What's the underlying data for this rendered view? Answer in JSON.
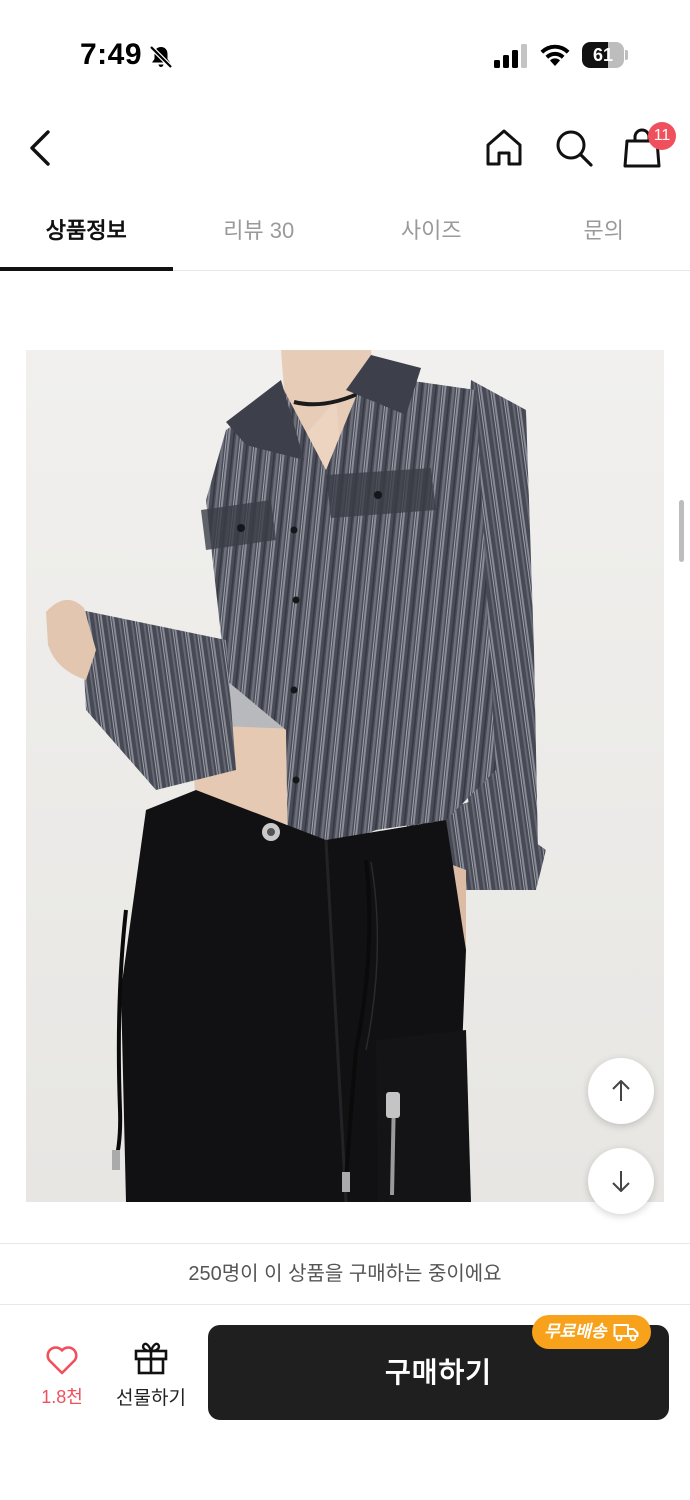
{
  "status_bar": {
    "time": "7:49",
    "battery": "61",
    "battery_level": 0.61
  },
  "header": {
    "cart_count": "11"
  },
  "tabs": [
    {
      "label": "상품정보",
      "active": true
    },
    {
      "label": "리뷰 30",
      "active": false
    },
    {
      "label": "사이즈",
      "active": false
    },
    {
      "label": "문의",
      "active": false
    }
  ],
  "buyers_banner": "250명이 이 상품을 구매하는 중이에요",
  "bottom_bar": {
    "like_count": "1.8천",
    "gift_label": "선물하기",
    "buy_label": "구매하기",
    "free_shipping": "무료배송"
  },
  "colors": {
    "accent": "#f0505c",
    "buy_button": "#1f1f1f",
    "badge": "#f7a21a"
  },
  "icons": [
    "bell-slash-icon",
    "signal-icon",
    "wifi-icon",
    "battery-icon",
    "chevron-left-icon",
    "home-icon",
    "search-icon",
    "shopping-bag-icon",
    "arrow-up-icon",
    "arrow-down-icon",
    "heart-icon",
    "gift-icon",
    "truck-icon"
  ]
}
